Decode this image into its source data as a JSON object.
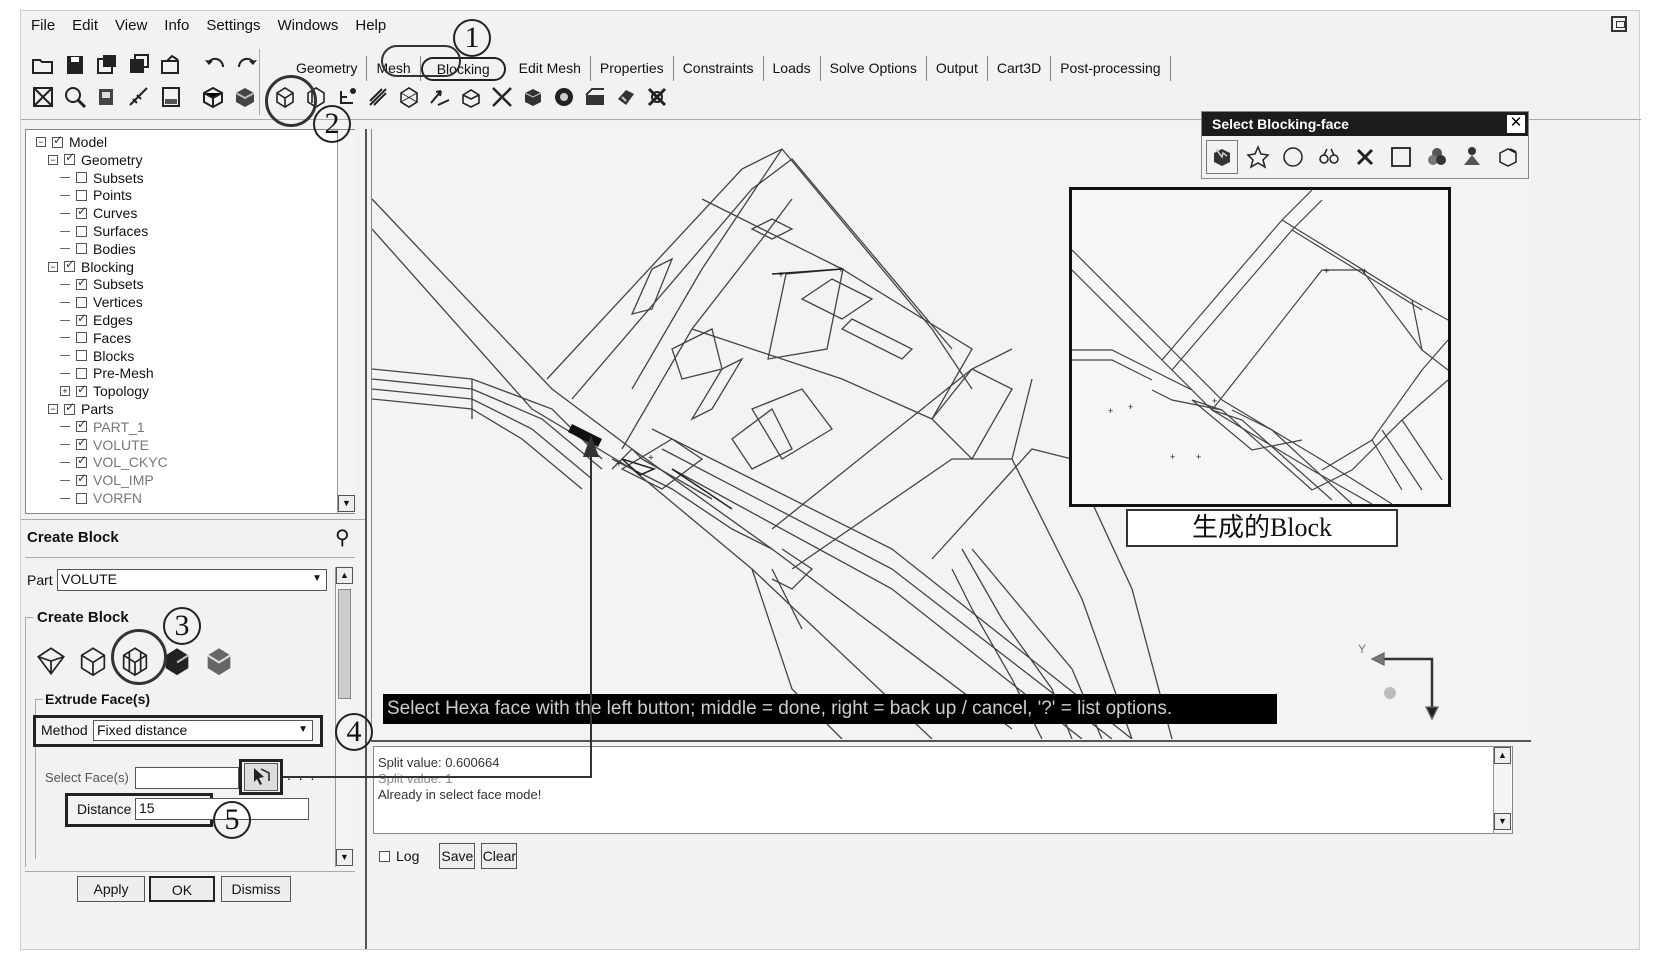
{
  "menu": [
    "File",
    "Edit",
    "View",
    "Info",
    "Settings",
    "Windows",
    "Help"
  ],
  "tabs": [
    "Geometry",
    "Mesh",
    "Blocking",
    "Edit Mesh",
    "Properties",
    "Constraints",
    "Loads",
    "Solve Options",
    "Output",
    "Cart3D",
    "Post-processing"
  ],
  "active_tab": "Blocking",
  "callouts": [
    "1",
    "2",
    "3",
    "4",
    "5"
  ],
  "tree": [
    {
      "label": "Model",
      "level": 0,
      "checked": true,
      "expander": "minus"
    },
    {
      "label": "Geometry",
      "level": 1,
      "checked": true,
      "expander": "minus"
    },
    {
      "label": "Subsets",
      "level": 2,
      "checked": false
    },
    {
      "label": "Points",
      "level": 2,
      "checked": false
    },
    {
      "label": "Curves",
      "level": 2,
      "checked": true
    },
    {
      "label": "Surfaces",
      "level": 2,
      "checked": false
    },
    {
      "label": "Bodies",
      "level": 2,
      "checked": false
    },
    {
      "label": "Blocking",
      "level": 1,
      "checked": true,
      "expander": "minus"
    },
    {
      "label": "Subsets",
      "level": 2,
      "checked": true
    },
    {
      "label": "Vertices",
      "level": 2,
      "checked": false
    },
    {
      "label": "Edges",
      "level": 2,
      "checked": true
    },
    {
      "label": "Faces",
      "level": 2,
      "checked": false
    },
    {
      "label": "Blocks",
      "level": 2,
      "checked": false
    },
    {
      "label": "Pre-Mesh",
      "level": 2,
      "checked": false
    },
    {
      "label": "Topology",
      "level": 2,
      "checked": true,
      "expander": "plus"
    },
    {
      "label": "Parts",
      "level": 1,
      "checked": true,
      "expander": "minus"
    },
    {
      "label": "PART_1",
      "level": 2,
      "checked": true,
      "gray": true
    },
    {
      "label": "VOLUTE",
      "level": 2,
      "checked": true,
      "gray": true
    },
    {
      "label": "VOL_CKYC",
      "level": 2,
      "checked": true,
      "gray": true
    },
    {
      "label": "VOL_IMP",
      "level": 2,
      "checked": true,
      "gray": true
    },
    {
      "label": "VORFN",
      "level": 2,
      "checked": false,
      "gray": true
    }
  ],
  "create_block": {
    "title": "Create Block",
    "part_label": "Part",
    "part_value": "VOLUTE",
    "section_title": "Create Block",
    "extrude_title": "Extrude Face(s)",
    "method_label": "Method",
    "method_value": "Fixed distance",
    "select_faces_label": "Select Face(s)",
    "distance_label": "Distance",
    "distance_value": "15",
    "buttons": {
      "apply": "Apply",
      "ok": "OK",
      "dismiss": "Dismiss"
    }
  },
  "select_toolbar_title": "Select Blocking-face",
  "inset_caption": "生成的Block",
  "prompt": "Select Hexa face with the left button; middle = done, right = back up / cancel, '?' = list options.",
  "messages": [
    "Split value: 0.600664",
    "Split value: 1",
    "Already in select face mode!"
  ],
  "message_bar": {
    "log": "Log",
    "save": "Save",
    "clear": "Clear"
  },
  "axis_label": "Y",
  "icons": {
    "toolbar_row1": [
      "open-folder-icon",
      "save-icon",
      "save-as-icon",
      "save-project-icon",
      "close-project-icon",
      "undo-icon",
      "redo-icon"
    ],
    "toolbar_row2": [
      "fit-window-icon",
      "zoom-icon",
      "display-icon",
      "measure-icon",
      "view-icon",
      "shade-icon",
      "solid-icon"
    ],
    "blocking_tools": [
      "create-block-icon",
      "split-block-icon",
      "vertex-icon",
      "edge-icon",
      "associate-icon",
      "move-vertex-icon",
      "transform-icon",
      "edit-block-icon",
      "premesh-icon",
      "delete-block-icon",
      "check-icon",
      "quality-icon",
      "parameters-icon",
      "smoothing-icon",
      "delete-icon"
    ],
    "select_tools": [
      "select-toggle-icon",
      "select-rubber-icon",
      "select-circle-icon",
      "select-polygon-icon",
      "select-cancel-icon",
      "select-box-icon",
      "select-all-icon",
      "select-part-icon",
      "select-visible-icon"
    ]
  }
}
